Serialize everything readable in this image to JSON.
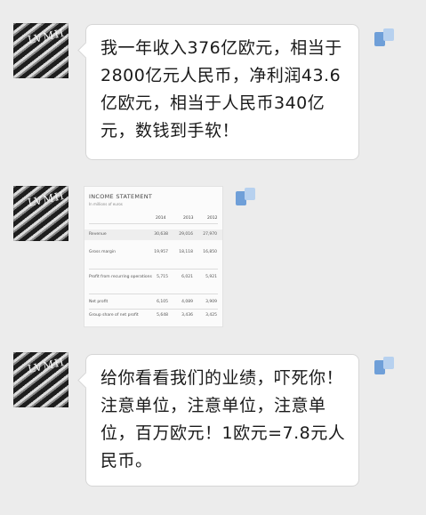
{
  "chat": {
    "messages": [
      {
        "text": "我一年收入376亿欧元，相当于2800亿元人民币，净利润43.6亿欧元，相当于人民币340亿元，数钱到手软！"
      },
      {
        "image_label": "INCOME STATEMENT"
      },
      {
        "text": "给你看看我们的业绩，吓死你！注意单位，注意单位，注意单位，百万欧元！1欧元=7.8元人民币。"
      }
    ]
  },
  "avatar": {
    "logo_text": "LVMH"
  },
  "document": {
    "title": "INCOME STATEMENT",
    "subtitle": "In millions of euros",
    "years": [
      "2014",
      "2013",
      "2012"
    ],
    "rows": [
      {
        "label": "Revenue",
        "values": [
          "30,638",
          "29,016",
          "27,970"
        ]
      },
      {
        "label": "Gross margin",
        "values": [
          "19,957",
          "18,118",
          "16,850"
        ]
      },
      {
        "label": "Profit from recurring operations",
        "values": [
          "5,715",
          "6,021",
          "5,921"
        ]
      },
      {
        "label": "Net profit",
        "values": [
          "6,105",
          "4,089",
          "3,909"
        ]
      },
      {
        "label": "Group share of net profit",
        "values": [
          "5,648",
          "3,436",
          "3,425"
        ]
      }
    ]
  },
  "accent_colors": {
    "mark_dark": "#6f9fd8",
    "mark_light": "#b7d1ef",
    "background": "#ececec"
  }
}
